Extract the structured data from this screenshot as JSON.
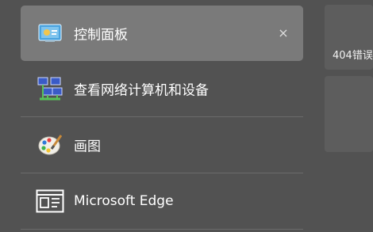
{
  "list": {
    "items": [
      {
        "label": "控制面板",
        "icon": "control-panel-icon",
        "selected": true,
        "close": "×"
      },
      {
        "label": "查看网络计算机和设备",
        "icon": "network-computers-icon",
        "selected": false
      },
      {
        "label": "画图",
        "icon": "paint-palette-icon",
        "selected": false
      },
      {
        "label": "Microsoft Edge",
        "icon": "edge-window-icon",
        "selected": false
      }
    ]
  },
  "right_panel": {
    "tiles": [
      {
        "text": "404错误"
      },
      {
        "text": ""
      }
    ]
  },
  "colors": {
    "background": "#525252",
    "selected": "#7a7a7a",
    "divider": "#6b6b6b"
  }
}
